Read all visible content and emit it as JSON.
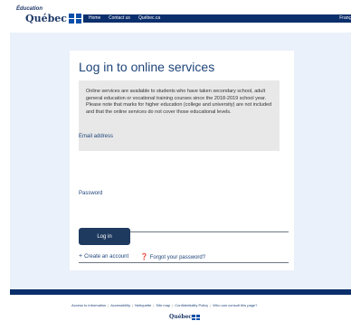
{
  "header": {
    "logo_small": "Éducation",
    "logo_big": "Québec",
    "nav": [
      "Home",
      "Contact us",
      "Québec.ca"
    ],
    "language": "Franç"
  },
  "card": {
    "title": "Log in to online services",
    "info_line1": "Online services are available to students who have taken secondary school, adult general education or vocational training courses since the 2018-2019 school year.",
    "info_line2": "Please note that marks for higher education (college and university) are not included and that the online services do not cover those educational levels.",
    "email_label": "Email address",
    "email_value": "",
    "password_label": "Password",
    "password_value": "",
    "login_button": "Log in",
    "create_account": "Create an account",
    "forgot_password": "Forgot your password?"
  },
  "footer": {
    "links": [
      "Access to information",
      "Accessibility",
      "Netiquette",
      "Site map",
      "Confidentiality Policy",
      "Who can consult this page?"
    ],
    "logo": "Québec"
  },
  "colors": {
    "navy": "#0b2f6c",
    "page_background": "#ebf1fa",
    "button": "#1e3a5f",
    "info_box": "#e8e8e8"
  },
  "icons": {
    "create_account": "plus-icon",
    "forgot_password": "question-circle-icon",
    "logo_flag": "fleur-de-lis-flag-icon"
  }
}
